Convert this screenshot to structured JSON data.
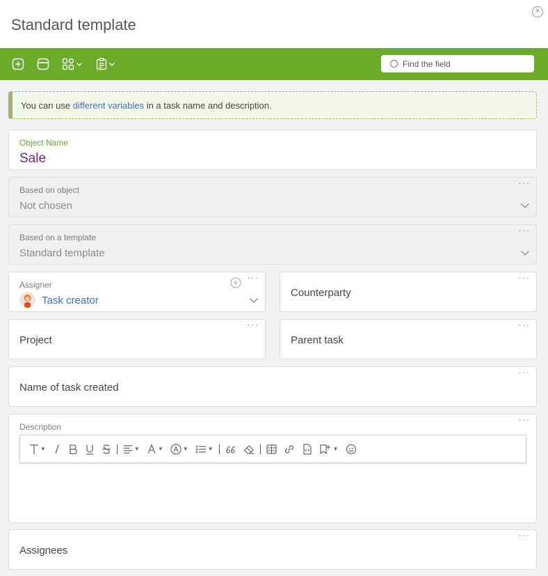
{
  "header": {
    "title": "Standard template",
    "close_label": "×"
  },
  "toolbar": {
    "search_placeholder": "Find the field"
  },
  "notice": {
    "prefix": "You can use ",
    "link": "different variables",
    "suffix": " in a task name and description."
  },
  "fields": {
    "object_name": {
      "label": "Object Name",
      "value": "Sale"
    },
    "based_on_object": {
      "label": "Based on object",
      "value": "Not chosen"
    },
    "based_on_template": {
      "label": "Based on a template",
      "value": "Standard template"
    },
    "assigner": {
      "label": "Assigner",
      "value": "Task creator"
    },
    "counterparty": {
      "label": "Counterparty"
    },
    "project": {
      "label": "Project"
    },
    "parent_task": {
      "label": "Parent task"
    },
    "name_of_task": {
      "label": "Name of task created"
    },
    "description": {
      "label": "Description"
    },
    "assignees": {
      "label": "Assignees"
    }
  },
  "icons": {
    "add": "plus-in-square-icon",
    "section": "section-icon",
    "widgets": "widgets-icon",
    "form": "form-icon",
    "more": "more-dots-icon"
  },
  "colors": {
    "toolbar": "#6aab2a",
    "link": "#3a74c4",
    "value_purple": "#7a1e8c",
    "label_green": "#6aab2a"
  }
}
